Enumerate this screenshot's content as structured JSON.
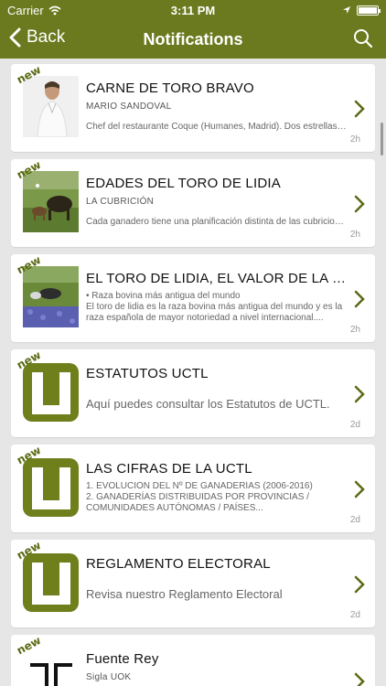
{
  "status": {
    "carrier": "Carrier",
    "time": "3:11 PM"
  },
  "nav": {
    "back_label": "Back",
    "title": "Notifications"
  },
  "colors": {
    "brand": "#6b7a1e",
    "accent": "#5a6b14"
  },
  "items": [
    {
      "badge": "new",
      "title": "CARNE DE TORO BRAVO",
      "subtitle": "MARIO SANDOVAL",
      "body": "Chef del restaurante Coque (Humanes, Madrid). Dos estrellas Michelin",
      "time": "2h",
      "thumb": "person-photo"
    },
    {
      "badge": "new",
      "title": "EDADES DEL TORO DE LIDIA",
      "subtitle": "LA CUBRICIÓN",
      "body": "Cada ganadero tiene una planificación distinta de las cubriciones",
      "time": "2h",
      "thumb": "cattle-photo"
    },
    {
      "badge": "new",
      "title": "EL TORO DE LIDIA, EL VALOR DE LA SOSTENIBILIDAD",
      "subtitle": "",
      "body": "• Raza bovina más antigua del mundo\nEl toro de lidia es la raza bovina más antigua del mundo y es la raza española de mayor notoriedad a nivel internacional....",
      "time": "2h",
      "thumb": "field-photo"
    },
    {
      "badge": "new",
      "title": "ESTATUTOS UCTL",
      "subtitle": "",
      "body": "Aquí puedes consultar los Estatutos de UCTL.",
      "time": "2d",
      "thumb": "uctl-logo"
    },
    {
      "badge": "new",
      "title": "LAS CIFRAS DE LA UCTL",
      "subtitle": "",
      "body": "1. EVOLUCIÓN DEL Nº DE GANADERÍAS (2006-2016)\n2. GANADERÍAS DISTRIBUIDAS POR PROVINCIAS / COMUNIDADES AUTÓNOMAS / PAÍSES...",
      "time": "2d",
      "thumb": "uctl-logo"
    },
    {
      "badge": "new",
      "title": "REGLAMENTO ELECTORAL",
      "subtitle": "",
      "body": "Revisa nuestro Reglamento Electoral",
      "time": "2d",
      "thumb": "uctl-logo"
    },
    {
      "badge": "new",
      "title": "Fuente Rey",
      "subtitle": "Sigla UOK",
      "body": "",
      "time": "",
      "thumb": "brand-mark"
    }
  ]
}
